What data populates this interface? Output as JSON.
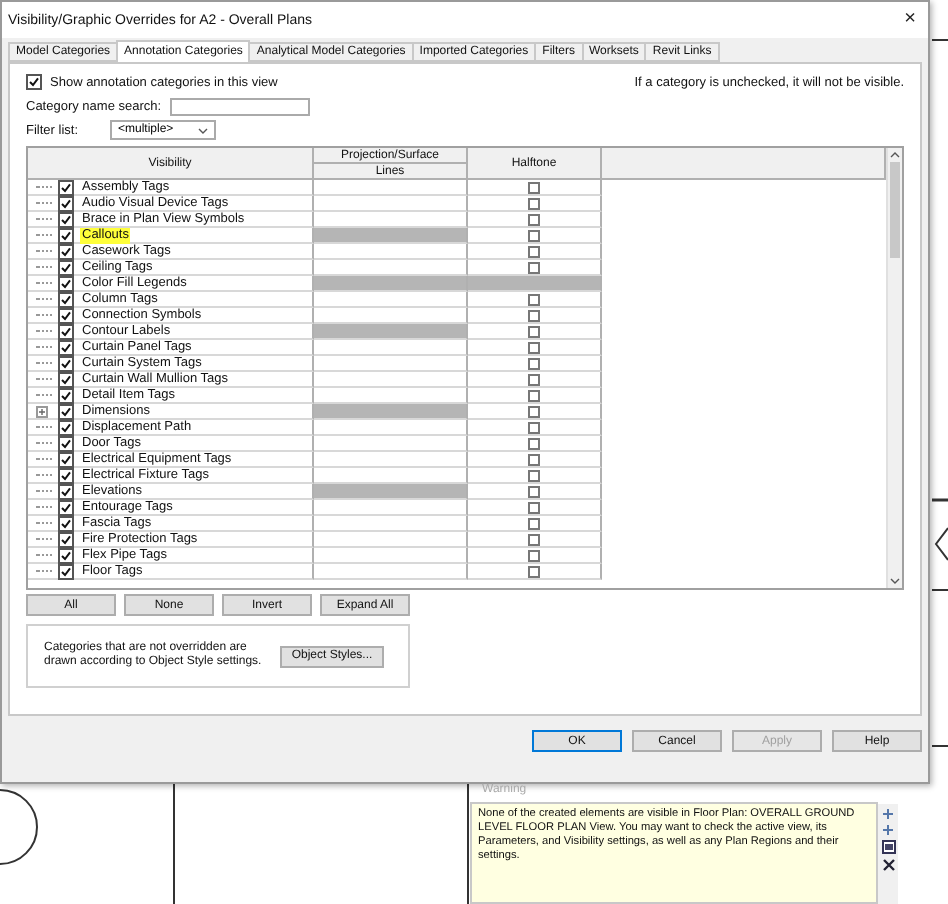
{
  "window": {
    "title": "Visibility/Graphic Overrides for A2 - Overall Plans",
    "close": "×"
  },
  "tabs": [
    {
      "label": "Model Categories",
      "selected": false
    },
    {
      "label": "Annotation Categories",
      "selected": true
    },
    {
      "label": "Analytical Model Categories",
      "selected": false
    },
    {
      "label": "Imported Categories",
      "selected": false
    },
    {
      "label": "Filters",
      "selected": false
    },
    {
      "label": "Worksets",
      "selected": false
    },
    {
      "label": "Revit Links",
      "selected": false
    }
  ],
  "show_annotation": {
    "label": "Show annotation categories in this view",
    "checked": true
  },
  "note": "If a category is unchecked, it will not be visible.",
  "search": {
    "label": "Category name search:"
  },
  "filter": {
    "label": "Filter list:",
    "value": "<multiple>"
  },
  "table": {
    "columns": {
      "visibility": "Visibility",
      "projection": "Projection/Surface",
      "lines": "Lines",
      "halftone": "Halftone"
    },
    "rows": [
      {
        "name": "Assembly Tags",
        "checked": true,
        "highlighted": false,
        "lines_disabled": false,
        "halftone_disabled": false,
        "expandable": false
      },
      {
        "name": "Audio Visual Device Tags",
        "checked": true,
        "highlighted": false,
        "lines_disabled": false,
        "halftone_disabled": false,
        "expandable": false
      },
      {
        "name": "Brace in Plan View Symbols",
        "checked": true,
        "highlighted": false,
        "lines_disabled": false,
        "halftone_disabled": false,
        "expandable": false
      },
      {
        "name": "Callouts",
        "checked": true,
        "highlighted": true,
        "lines_disabled": true,
        "halftone_disabled": false,
        "expandable": false
      },
      {
        "name": "Casework Tags",
        "checked": true,
        "highlighted": false,
        "lines_disabled": false,
        "halftone_disabled": false,
        "expandable": false
      },
      {
        "name": "Ceiling Tags",
        "checked": true,
        "highlighted": false,
        "lines_disabled": false,
        "halftone_disabled": false,
        "expandable": false
      },
      {
        "name": "Color Fill Legends",
        "checked": true,
        "highlighted": false,
        "lines_disabled": true,
        "halftone_disabled": true,
        "expandable": false
      },
      {
        "name": "Column Tags",
        "checked": true,
        "highlighted": false,
        "lines_disabled": false,
        "halftone_disabled": false,
        "expandable": false
      },
      {
        "name": "Connection Symbols",
        "checked": true,
        "highlighted": false,
        "lines_disabled": false,
        "halftone_disabled": false,
        "expandable": false
      },
      {
        "name": "Contour Labels",
        "checked": true,
        "highlighted": false,
        "lines_disabled": true,
        "halftone_disabled": false,
        "expandable": false
      },
      {
        "name": "Curtain Panel Tags",
        "checked": true,
        "highlighted": false,
        "lines_disabled": false,
        "halftone_disabled": false,
        "expandable": false
      },
      {
        "name": "Curtain System Tags",
        "checked": true,
        "highlighted": false,
        "lines_disabled": false,
        "halftone_disabled": false,
        "expandable": false
      },
      {
        "name": "Curtain Wall Mullion Tags",
        "checked": true,
        "highlighted": false,
        "lines_disabled": false,
        "halftone_disabled": false,
        "expandable": false
      },
      {
        "name": "Detail Item Tags",
        "checked": true,
        "highlighted": false,
        "lines_disabled": false,
        "halftone_disabled": false,
        "expandable": false
      },
      {
        "name": "Dimensions",
        "checked": true,
        "highlighted": false,
        "lines_disabled": true,
        "halftone_disabled": false,
        "expandable": true
      },
      {
        "name": "Displacement Path",
        "checked": true,
        "highlighted": false,
        "lines_disabled": false,
        "halftone_disabled": false,
        "expandable": false
      },
      {
        "name": "Door Tags",
        "checked": true,
        "highlighted": false,
        "lines_disabled": false,
        "halftone_disabled": false,
        "expandable": false
      },
      {
        "name": "Electrical Equipment Tags",
        "checked": true,
        "highlighted": false,
        "lines_disabled": false,
        "halftone_disabled": false,
        "expandable": false
      },
      {
        "name": "Electrical Fixture Tags",
        "checked": true,
        "highlighted": false,
        "lines_disabled": false,
        "halftone_disabled": false,
        "expandable": false
      },
      {
        "name": "Elevations",
        "checked": true,
        "highlighted": false,
        "lines_disabled": true,
        "halftone_disabled": false,
        "expandable": false
      },
      {
        "name": "Entourage Tags",
        "checked": true,
        "highlighted": false,
        "lines_disabled": false,
        "halftone_disabled": false,
        "expandable": false
      },
      {
        "name": "Fascia Tags",
        "checked": true,
        "highlighted": false,
        "lines_disabled": false,
        "halftone_disabled": false,
        "expandable": false
      },
      {
        "name": "Fire Protection Tags",
        "checked": true,
        "highlighted": false,
        "lines_disabled": false,
        "halftone_disabled": false,
        "expandable": false
      },
      {
        "name": "Flex Pipe Tags",
        "checked": true,
        "highlighted": false,
        "lines_disabled": false,
        "halftone_disabled": false,
        "expandable": false
      },
      {
        "name": "Floor Tags",
        "checked": true,
        "highlighted": false,
        "lines_disabled": false,
        "halftone_disabled": false,
        "expandable": false
      }
    ]
  },
  "table_buttons": [
    "All",
    "None",
    "Invert",
    "Expand All"
  ],
  "styles_note": "Categories that are not overridden are drawn according to Object Style settings.",
  "object_styles_button": "Object Styles...",
  "footer_buttons": [
    {
      "label": "OK",
      "default": true,
      "disabled": false
    },
    {
      "label": "Cancel",
      "default": false,
      "disabled": false
    },
    {
      "label": "Apply",
      "default": false,
      "disabled": true
    },
    {
      "label": "Help",
      "default": false,
      "disabled": false
    }
  ],
  "warning": {
    "title": "Warning",
    "message": "None of the created elements are visible in Floor Plan: OVERALL GROUND LEVEL FLOOR PLAN View. You may want to check the active view, its Parameters, and Visibility settings, as well as any Plan Regions and their settings."
  }
}
